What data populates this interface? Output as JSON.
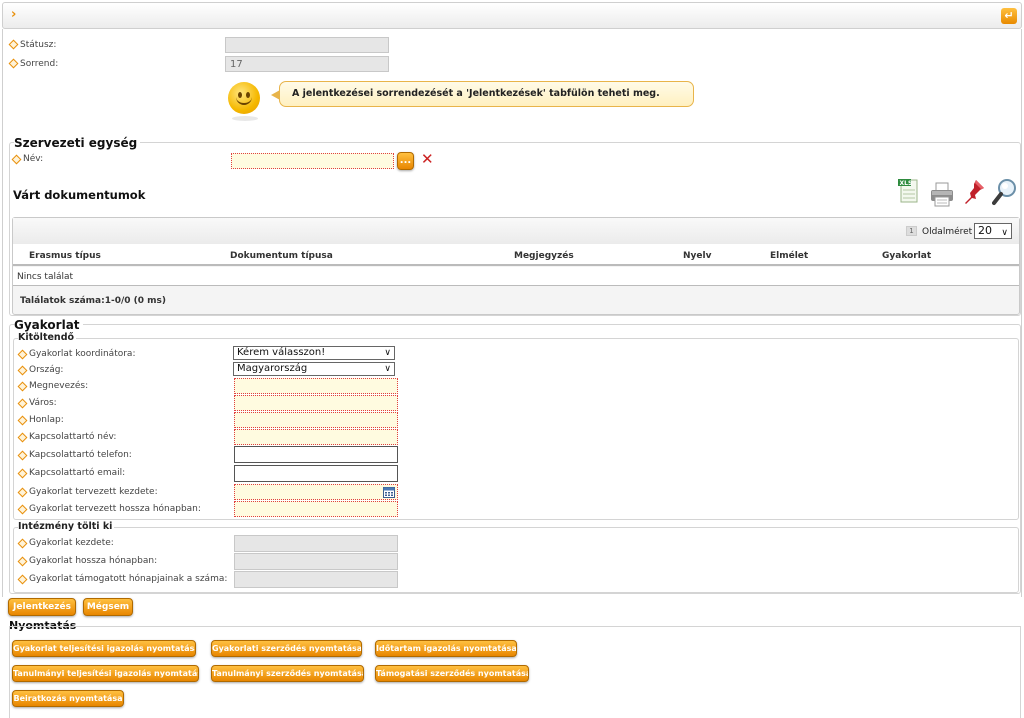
{
  "status": {
    "label": "Státusz:",
    "value": ""
  },
  "order": {
    "label": "Sorrend:",
    "value": "17"
  },
  "hint": "A jelentkezései sorrendezését a 'Jelentkezések' tabfülön teheti meg.",
  "org": {
    "title": "Szervezeti egység",
    "name_label": "Név:",
    "name_value": "",
    "browse_label": "..."
  },
  "docs": {
    "title": "Várt dokumentumok",
    "page_number": "1",
    "page_size_label": "Oldalméret",
    "page_size_value": "20",
    "columns": [
      "Erasmus típus",
      "Dokumentum típusa",
      "Megjegyzés",
      "Nyelv",
      "Elmélet",
      "Gyakorlat"
    ],
    "empty_text": "Nincs találat",
    "results_text": "Találatok száma:1-0/0 (0 ms)"
  },
  "practice": {
    "title": "Gyakorlat",
    "fill_title": "Kitöltendő",
    "fields": [
      {
        "label": "Gyakorlat koordinátora:",
        "value": "Kérem válasszon!"
      },
      {
        "label": "Ország:",
        "value": "Magyarország"
      },
      {
        "label": "Megnevezés:",
        "value": ""
      },
      {
        "label": "Város:",
        "value": ""
      },
      {
        "label": "Honlap:",
        "value": ""
      },
      {
        "label": "Kapcsolattartó név:",
        "value": ""
      },
      {
        "label": "Kapcsolattartó telefon:",
        "value": ""
      },
      {
        "label": "Kapcsolattartó email:",
        "value": ""
      },
      {
        "label": "Gyakorlat tervezett kezdete:",
        "value": ""
      },
      {
        "label": "Gyakorlat tervezett hossza hónapban:",
        "value": ""
      }
    ],
    "inst_title": "Intézmény tölti ki",
    "inst_fields": [
      {
        "label": "Gyakorlat kezdete:",
        "value": ""
      },
      {
        "label": "Gyakorlat hossza hónapban:",
        "value": ""
      },
      {
        "label": "Gyakorlat támogatott hónapjainak a száma:",
        "value": ""
      }
    ]
  },
  "actions": {
    "apply": "Jelentkezés",
    "cancel": "Mégsem"
  },
  "print": {
    "title": "Nyomtatás",
    "buttons": [
      "Gyakorlat teljesítési igazolás nyomtatása",
      "Gyakorlati szerződés nyomtatása",
      "Időtartam igazolás nyomtatása",
      "Tanulmányi teljesítési igazolás nyomtatása",
      "Tanulmányi szerződés nyomtatása",
      "Támogatási szerződés nyomtatása",
      "Beiratkozás nyomtatása"
    ]
  },
  "colors": {
    "accent": "#e88600",
    "required_bg": "#fffbe0",
    "required_border": "#e04040"
  }
}
